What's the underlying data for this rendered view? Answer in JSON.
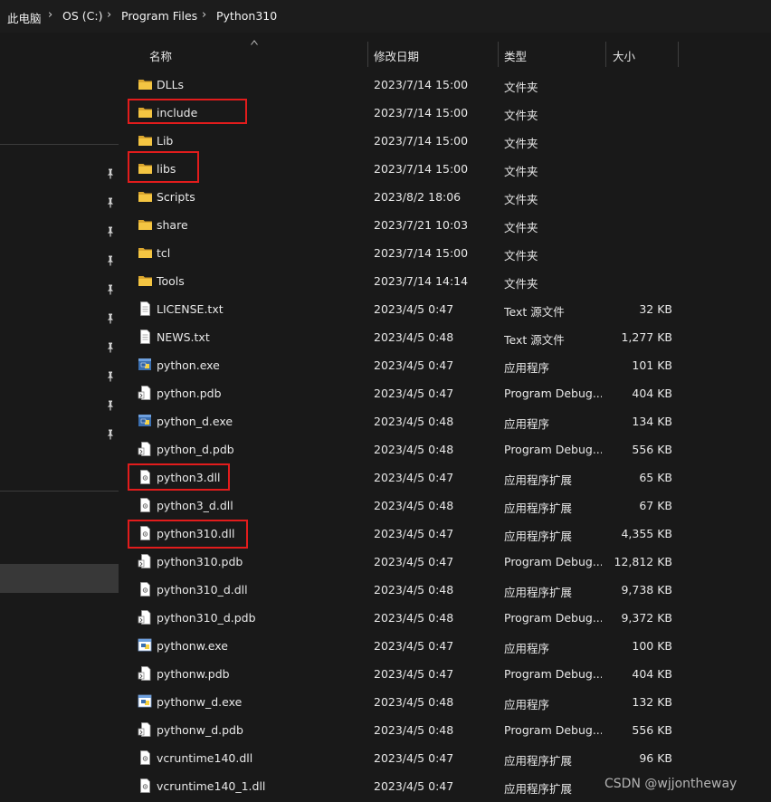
{
  "breadcrumb": [
    "此电脑",
    "OS (C:)",
    "Program Files",
    "Python310"
  ],
  "columns": {
    "name": "名称",
    "date": "修改日期",
    "type": "类型",
    "size": "大小"
  },
  "files": [
    {
      "name": "DLLs",
      "date": "2023/7/14 15:00",
      "type": "文件夹",
      "size": "",
      "icon": "folder-icon"
    },
    {
      "name": "include",
      "date": "2023/7/14 15:00",
      "type": "文件夹",
      "size": "",
      "icon": "folder-icon"
    },
    {
      "name": "Lib",
      "date": "2023/7/14 15:00",
      "type": "文件夹",
      "size": "",
      "icon": "folder-icon"
    },
    {
      "name": "libs",
      "date": "2023/7/14 15:00",
      "type": "文件夹",
      "size": "",
      "icon": "folder-icon"
    },
    {
      "name": "Scripts",
      "date": "2023/8/2 18:06",
      "type": "文件夹",
      "size": "",
      "icon": "folder-icon"
    },
    {
      "name": "share",
      "date": "2023/7/21 10:03",
      "type": "文件夹",
      "size": "",
      "icon": "folder-icon"
    },
    {
      "name": "tcl",
      "date": "2023/7/14 15:00",
      "type": "文件夹",
      "size": "",
      "icon": "folder-icon"
    },
    {
      "name": "Tools",
      "date": "2023/7/14 14:14",
      "type": "文件夹",
      "size": "",
      "icon": "folder-icon"
    },
    {
      "name": "LICENSE.txt",
      "date": "2023/4/5 0:47",
      "type": "Text 源文件",
      "size": "32 KB",
      "icon": "text-file-icon"
    },
    {
      "name": "NEWS.txt",
      "date": "2023/4/5 0:48",
      "type": "Text 源文件",
      "size": "1,277 KB",
      "icon": "text-file-icon"
    },
    {
      "name": "python.exe",
      "date": "2023/4/5 0:47",
      "type": "应用程序",
      "size": "101 KB",
      "icon": "python-exe-icon"
    },
    {
      "name": "python.pdb",
      "date": "2023/4/5 0:47",
      "type": "Program Debug...",
      "size": "404 KB",
      "icon": "pdb-file-icon"
    },
    {
      "name": "python_d.exe",
      "date": "2023/4/5 0:48",
      "type": "应用程序",
      "size": "134 KB",
      "icon": "python-exe-icon"
    },
    {
      "name": "python_d.pdb",
      "date": "2023/4/5 0:48",
      "type": "Program Debug...",
      "size": "556 KB",
      "icon": "pdb-file-icon"
    },
    {
      "name": "python3.dll",
      "date": "2023/4/5 0:47",
      "type": "应用程序扩展",
      "size": "65 KB",
      "icon": "dll-file-icon"
    },
    {
      "name": "python3_d.dll",
      "date": "2023/4/5 0:48",
      "type": "应用程序扩展",
      "size": "67 KB",
      "icon": "dll-file-icon"
    },
    {
      "name": "python310.dll",
      "date": "2023/4/5 0:47",
      "type": "应用程序扩展",
      "size": "4,355 KB",
      "icon": "dll-file-icon"
    },
    {
      "name": "python310.pdb",
      "date": "2023/4/5 0:47",
      "type": "Program Debug...",
      "size": "12,812 KB",
      "icon": "pdb-file-icon"
    },
    {
      "name": "python310_d.dll",
      "date": "2023/4/5 0:48",
      "type": "应用程序扩展",
      "size": "9,738 KB",
      "icon": "dll-file-icon"
    },
    {
      "name": "python310_d.pdb",
      "date": "2023/4/5 0:48",
      "type": "Program Debug...",
      "size": "9,372 KB",
      "icon": "pdb-file-icon"
    },
    {
      "name": "pythonw.exe",
      "date": "2023/4/5 0:47",
      "type": "应用程序",
      "size": "100 KB",
      "icon": "pythonw-exe-icon"
    },
    {
      "name": "pythonw.pdb",
      "date": "2023/4/5 0:47",
      "type": "Program Debug...",
      "size": "404 KB",
      "icon": "pdb-file-icon"
    },
    {
      "name": "pythonw_d.exe",
      "date": "2023/4/5 0:48",
      "type": "应用程序",
      "size": "132 KB",
      "icon": "pythonw-exe-icon"
    },
    {
      "name": "pythonw_d.pdb",
      "date": "2023/4/5 0:48",
      "type": "Program Debug...",
      "size": "556 KB",
      "icon": "pdb-file-icon"
    },
    {
      "name": "vcruntime140.dll",
      "date": "2023/4/5 0:47",
      "type": "应用程序扩展",
      "size": "96 KB",
      "icon": "dll-file-icon"
    },
    {
      "name": "vcruntime140_1.dll",
      "date": "2023/4/5 0:47",
      "type": "应用程序扩展",
      "size": "",
      "icon": "dll-file-icon"
    }
  ],
  "highlighted": [
    "include",
    "libs",
    "python3.dll",
    "python310.dll"
  ],
  "watermark": "CSDN @wjjontheway",
  "colors": {
    "background": "#191919",
    "highlight_box": "#e21c1c",
    "folder": "#f2c14e"
  }
}
